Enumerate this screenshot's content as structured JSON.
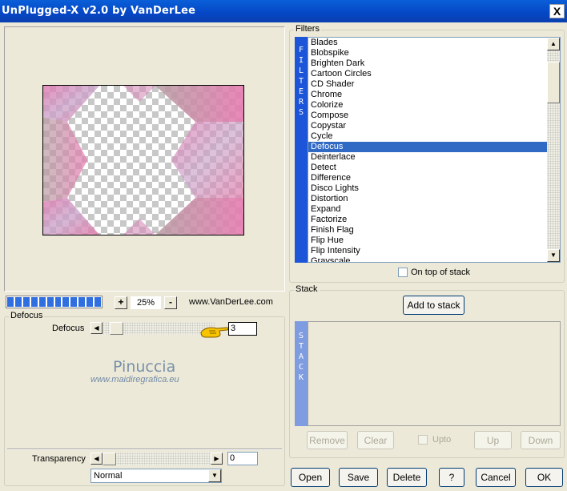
{
  "window": {
    "title": "UnPlugged-X v2.0 by VanDerLee",
    "close": "X"
  },
  "preview": {
    "zoom": "25%",
    "zoom_in": "+",
    "zoom_out": "-",
    "website": "www.VanDerLee.com",
    "progress_segments": 12
  },
  "filters": {
    "group_label": "Filters",
    "side_label": [
      "F",
      "I",
      "L",
      "T",
      "E",
      "R",
      "S"
    ],
    "items": [
      "Blades",
      "Blobspike",
      "Brighten Dark",
      "Cartoon Circles",
      "CD Shader",
      "Chrome",
      "Colorize",
      "Compose",
      "Copystar",
      "Cycle",
      "Defocus",
      "Deinterlace",
      "Detect",
      "Difference",
      "Disco Lights",
      "Distortion",
      "Expand",
      "Factorize",
      "Finish Flag",
      "Flip Hue",
      "Flip Intensity",
      "Grayscale"
    ],
    "selected": "Defocus",
    "on_top_label": "On top of stack"
  },
  "params": {
    "group_label": "Defocus",
    "defocus_label": "Defocus",
    "defocus_value": "3",
    "watermark_name": "Pinuccia",
    "watermark_url": "www.maidiregrafica.eu",
    "transparency_label": "Transparency",
    "transparency_value": "0",
    "blend_mode": "Normal"
  },
  "stack": {
    "group_label": "Stack",
    "add_button": "Add to stack",
    "side_label": [
      "S",
      "T",
      "A",
      "C",
      "K"
    ],
    "remove": "Remove",
    "clear": "Clear",
    "upto": "Upto",
    "up": "Up",
    "down": "Down"
  },
  "footer": {
    "open": "Open",
    "save": "Save",
    "delete": "Delete",
    "help": "?",
    "cancel": "Cancel",
    "ok": "OK"
  },
  "colors": {
    "titlebar": "#0546c5",
    "selection": "#316ac5",
    "panel": "#ece9d8",
    "side_strip": "#1c55d8",
    "stack_strip": "#7f9ce0"
  }
}
